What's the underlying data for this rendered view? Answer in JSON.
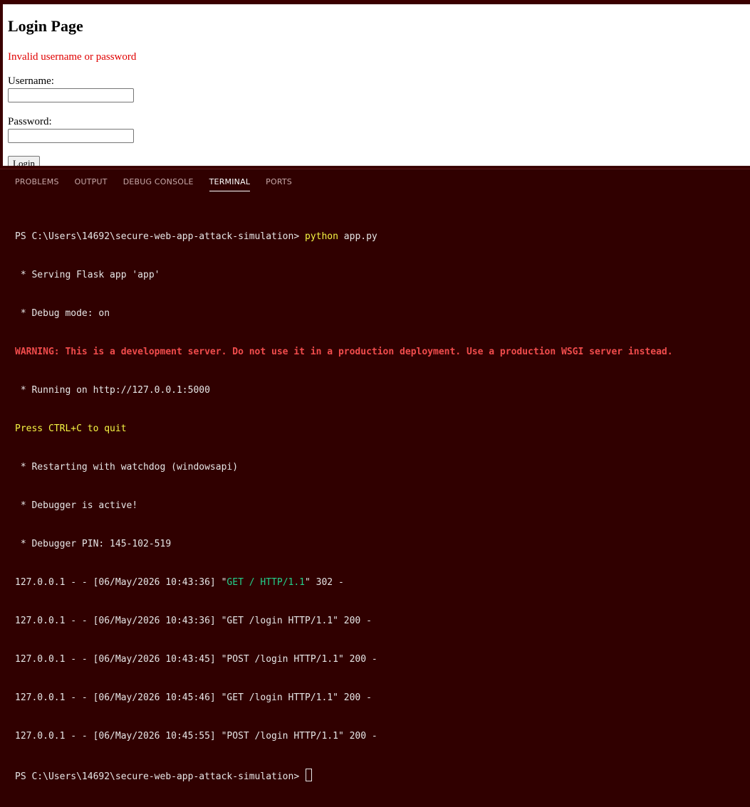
{
  "login_page": {
    "title": "Login Page",
    "error_message": "Invalid username or password",
    "username_label": "Username:",
    "username_value": "",
    "password_label": "Password:",
    "password_value": "",
    "login_button": "Login"
  },
  "panel": {
    "tabs": [
      {
        "label": "PROBLEMS"
      },
      {
        "label": "OUTPUT"
      },
      {
        "label": "DEBUG CONSOLE"
      },
      {
        "label": "TERMINAL"
      },
      {
        "label": "PORTS"
      }
    ],
    "active_tab": "TERMINAL"
  },
  "terminal": {
    "prompt1": "PS C:\\Users\\14692\\secure-web-app-attack-simulation> ",
    "cmd_python": "python",
    "cmd_args": " app.py",
    "line_serving": " * Serving Flask app 'app'",
    "line_debug": " * Debug mode: on",
    "line_warning": "WARNING: This is a development server. Do not use it in a production deployment. Use a production WSGI server instead.",
    "line_running": " * Running on http://127.0.0.1:5000",
    "line_quit": "Press CTRL+C to quit",
    "line_restart": " * Restarting with watchdog (windowsapi)",
    "line_debugger": " * Debugger is active!",
    "line_pin": " * Debugger PIN: 145-102-519",
    "log1_pre": "127.0.0.1 - - [06/May/2026 10:43:36] \"",
    "log1_req": "GET / HTTP/1.1",
    "log1_post": "\" 302 -",
    "log2": "127.0.0.1 - - [06/May/2026 10:43:36] \"GET /login HTTP/1.1\" 200 -",
    "log3": "127.0.0.1 - - [06/May/2026 10:43:45] \"POST /login HTTP/1.1\" 200 -",
    "log4": "127.0.0.1 - - [06/May/2026 10:45:46] \"GET /login HTTP/1.1\" 200 -",
    "log5": "127.0.0.1 - - [06/May/2026 10:45:55] \"POST /login HTTP/1.1\" 200 -",
    "prompt2": "PS C:\\Users\\14692\\secure-web-app-attack-simulation> "
  },
  "colors": {
    "panel_bg": "#300000",
    "warning": "#f14c4c",
    "highlight_yellow": "#f5f543",
    "success_green": "#23d18b",
    "error_red": "#e00000"
  }
}
